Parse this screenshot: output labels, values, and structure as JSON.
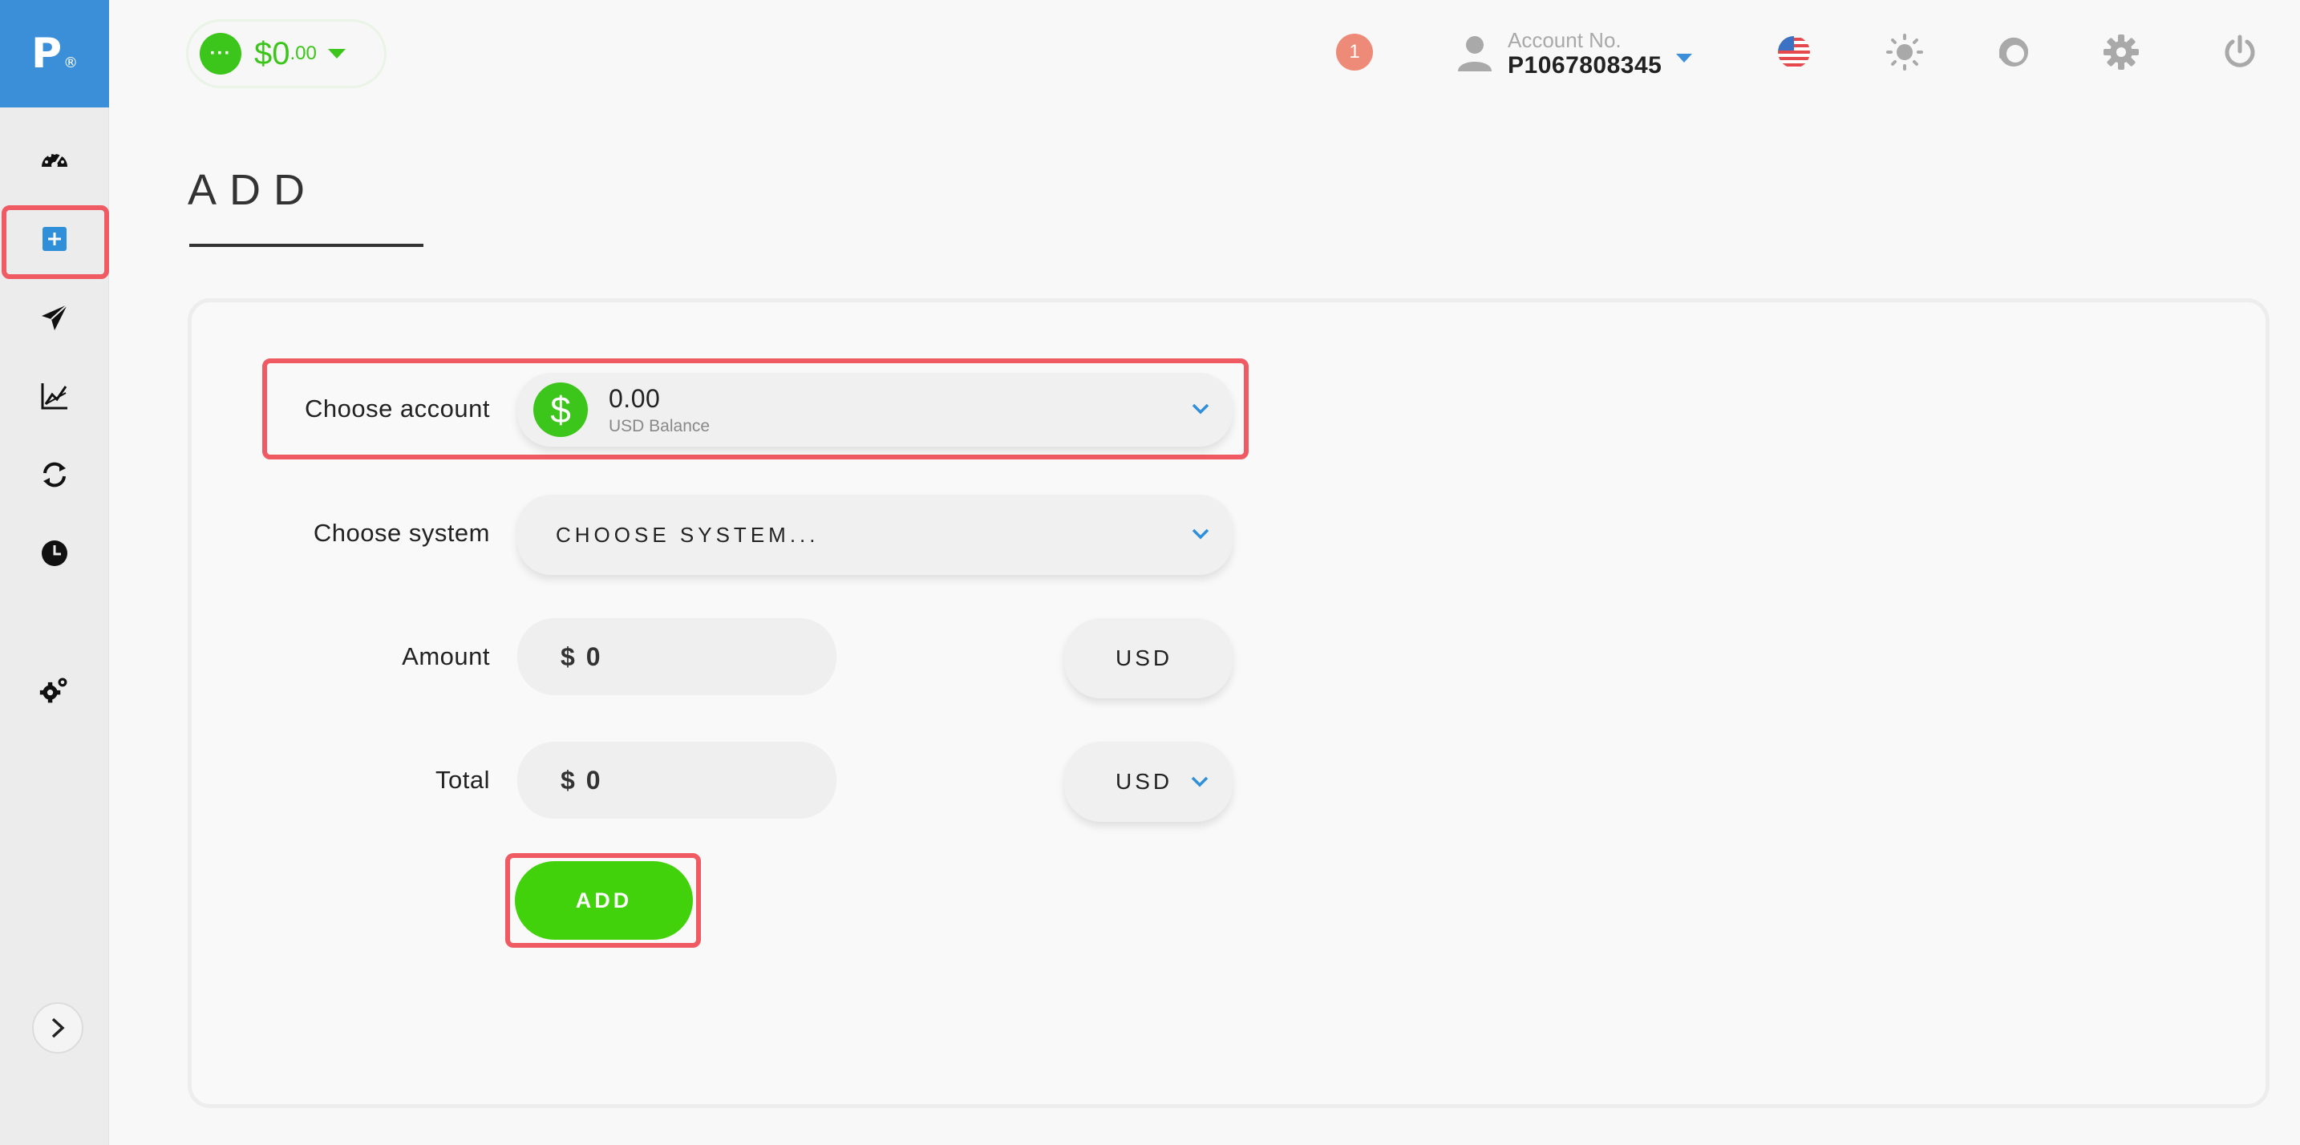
{
  "logo": {
    "letter": "P",
    "mark": "®"
  },
  "sidebar": {
    "items": [
      {
        "name": "dashboard",
        "icon": "speedometer-icon"
      },
      {
        "name": "add",
        "icon": "plus-square-icon",
        "active": true
      },
      {
        "name": "send",
        "icon": "paper-plane-icon"
      },
      {
        "name": "statistics",
        "icon": "chart-line-icon"
      },
      {
        "name": "exchange",
        "icon": "refresh-icon"
      },
      {
        "name": "history",
        "icon": "clock-icon"
      },
      {
        "name": "settings",
        "icon": "gears-icon"
      }
    ],
    "expand_icon": "chevron-right-icon"
  },
  "topbar": {
    "balance_main": "$0",
    "balance_cents": ".00",
    "notification_count": "1",
    "account_label": "Account No.",
    "account_number": "P1067808345",
    "icons": [
      "us-flag-icon",
      "sun-icon",
      "support-agent-icon",
      "gear-icon",
      "power-icon"
    ]
  },
  "page": {
    "title": "ADD"
  },
  "form": {
    "choose_account_label": "Choose account",
    "account_value": "0.00",
    "account_sub": "USD Balance",
    "choose_system_label": "Choose system",
    "system_placeholder": "CHOOSE SYSTEM...",
    "amount_label": "Amount",
    "amount_currency_symbol": "$",
    "amount_value": "0",
    "amount_currency": "USD",
    "total_label": "Total",
    "total_currency_symbol": "$",
    "total_value": "0",
    "total_currency": "USD",
    "add_button": "ADD"
  },
  "colors": {
    "brand_blue": "#3b8fd9",
    "green": "#42d20c",
    "highlight_red": "#f05a62",
    "notification": "#ee8a78"
  }
}
